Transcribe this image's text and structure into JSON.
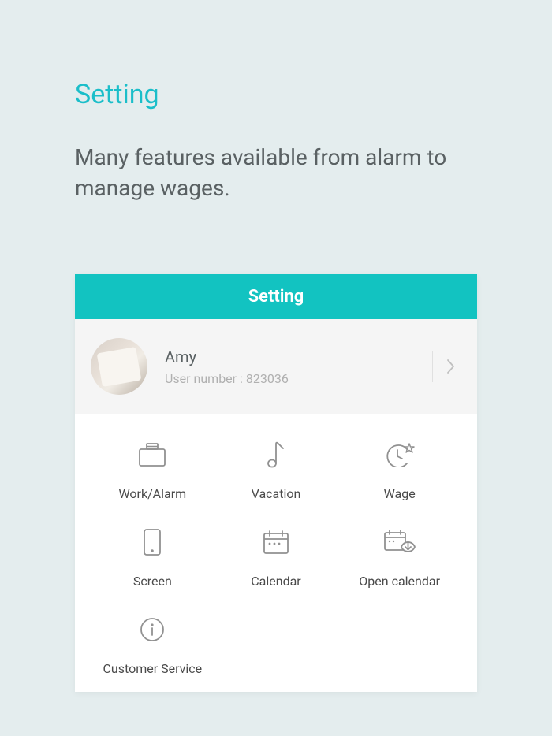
{
  "header": {
    "title": "Setting",
    "subtitle": "Many features available from alarm to manage wages."
  },
  "app": {
    "title": "Setting",
    "profile": {
      "name": "Amy",
      "userNumberLabel": "User number : 823036"
    },
    "menu": {
      "items": [
        {
          "label": "Work/Alarm"
        },
        {
          "label": "Vacation"
        },
        {
          "label": "Wage"
        },
        {
          "label": "Screen"
        },
        {
          "label": "Calendar"
        },
        {
          "label": "Open calendar"
        },
        {
          "label": "Customer Service"
        }
      ]
    }
  },
  "colors": {
    "accent": "#12c3c1",
    "titleAccent": "#1bbec9"
  }
}
